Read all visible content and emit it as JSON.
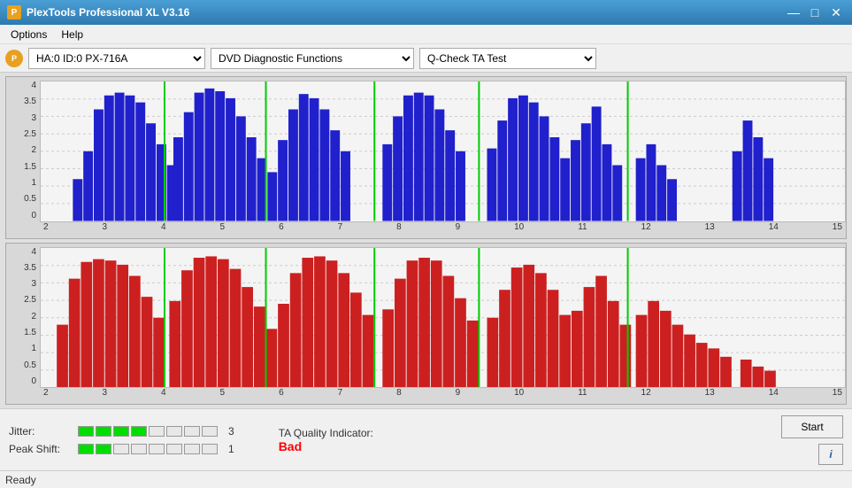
{
  "titleBar": {
    "title": "PlexTools Professional XL V3.16",
    "icon": "P",
    "minimize": "—",
    "maximize": "□",
    "close": "✕"
  },
  "menuBar": {
    "items": [
      "Options",
      "Help"
    ]
  },
  "toolbar": {
    "driveOptions": [
      "HA:0 ID:0  PX-716A"
    ],
    "driveSelected": "HA:0 ID:0  PX-716A",
    "functionOptions": [
      "DVD Diagnostic Functions"
    ],
    "functionSelected": "DVD Diagnostic Functions",
    "testOptions": [
      "Q-Check TA Test"
    ],
    "testSelected": "Q-Check TA Test"
  },
  "charts": {
    "topChart": {
      "yLabels": [
        "4",
        "3.5",
        "3",
        "2.5",
        "2",
        "1.5",
        "1",
        "0.5",
        "0"
      ],
      "xLabels": [
        "2",
        "3",
        "4",
        "5",
        "6",
        "7",
        "8",
        "9",
        "10",
        "11",
        "12",
        "13",
        "14",
        "15"
      ],
      "barColor": "#2020cc",
      "greenLinePositions": [
        3,
        4,
        6,
        8,
        11
      ]
    },
    "bottomChart": {
      "yLabels": [
        "4",
        "3.5",
        "3",
        "2.5",
        "2",
        "1.5",
        "1",
        "0.5",
        "0"
      ],
      "xLabels": [
        "2",
        "3",
        "4",
        "5",
        "6",
        "7",
        "8",
        "9",
        "10",
        "11",
        "12",
        "13",
        "14",
        "15"
      ],
      "barColor": "#cc2020",
      "greenLinePositions": [
        3,
        4,
        6,
        8,
        11
      ]
    }
  },
  "bottomBar": {
    "jitter": {
      "label": "Jitter:",
      "filledBlocks": 4,
      "totalBlocks": 8,
      "value": "3"
    },
    "peakShift": {
      "label": "Peak Shift:",
      "filledBlocks": 2,
      "totalBlocks": 8,
      "value": "1"
    },
    "taQuality": {
      "label": "TA Quality Indicator:",
      "value": "Bad",
      "color": "red"
    },
    "startButton": "Start",
    "infoButton": "i"
  },
  "statusBar": {
    "text": "Ready"
  }
}
